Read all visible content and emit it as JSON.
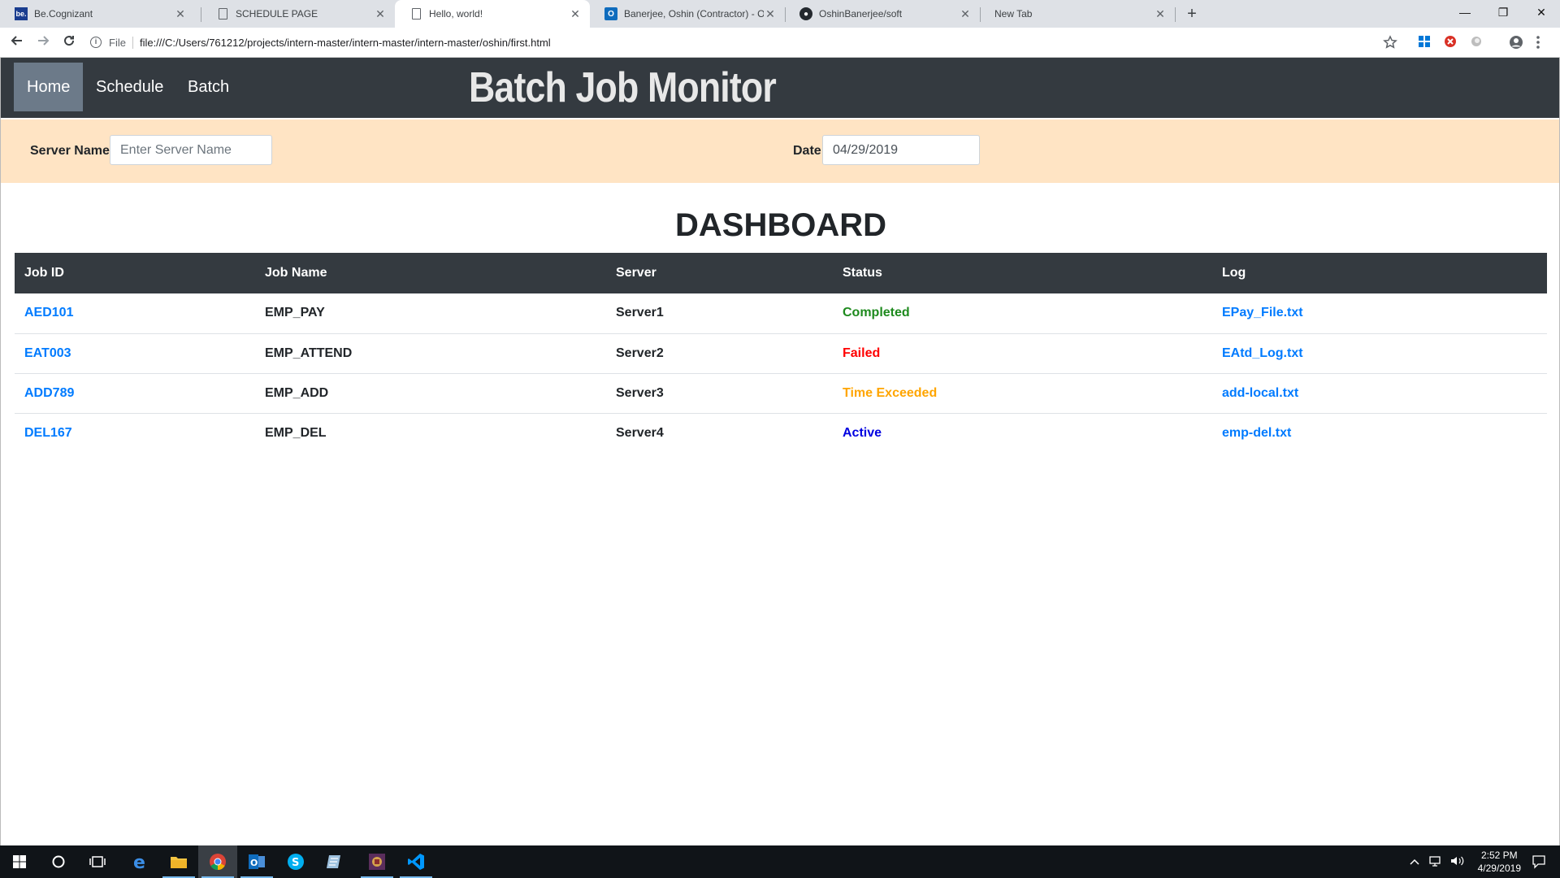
{
  "browser": {
    "tabs": [
      {
        "title": "Be.Cognizant",
        "icon": "be-icon",
        "icon_text": "be."
      },
      {
        "title": "SCHEDULE PAGE",
        "icon": "document-icon",
        "icon_text": ""
      },
      {
        "title": "Hello, world!",
        "icon": "document-icon",
        "icon_text": ""
      },
      {
        "title": "Banerjee, Oshin (Contractor) - Ou",
        "icon": "outlook-icon",
        "icon_text": "O"
      },
      {
        "title": "OshinBanerjee/soft",
        "icon": "github-icon",
        "icon_text": "●"
      },
      {
        "title": "New Tab",
        "icon": "",
        "icon_text": ""
      }
    ],
    "new_tab_glyph": "+",
    "window_controls": {
      "minimize": "—",
      "restore": "❐",
      "close": "✕"
    },
    "address": {
      "scheme_label": "File",
      "url": "file:///C:/Users/761212/projects/intern-master/intern-master/intern-master/oshin/first.html"
    }
  },
  "navbar": {
    "links": [
      {
        "label": "Home"
      },
      {
        "label": "Schedule"
      },
      {
        "label": "Batch"
      }
    ],
    "brand": "Batch Job Monitor"
  },
  "filters": {
    "server_label": "Server Name",
    "server_placeholder": "Enter Server Name",
    "date_label": "Date",
    "date_value": "04/29/2019"
  },
  "dashboard": {
    "title": "DASHBOARD",
    "columns": [
      "Job ID",
      "Job Name",
      "Server",
      "Status",
      "Log"
    ],
    "rows": [
      {
        "job_id": "AED101",
        "job_name": "EMP_PAY",
        "server": "Server1",
        "status": "Completed",
        "status_color": "#1e8a1e",
        "log": "EPay_File.txt"
      },
      {
        "job_id": "EAT003",
        "job_name": "EMP_ATTEND",
        "server": "Server2",
        "status": "Failed",
        "status_color": "#ff0000",
        "log": "EAtd_Log.txt"
      },
      {
        "job_id": "ADD789",
        "job_name": "EMP_ADD",
        "server": "Server3",
        "status": "Time Exceeded",
        "status_color": "#ffa500",
        "log": "add-local.txt"
      },
      {
        "job_id": "DEL167",
        "job_name": "EMP_DEL",
        "server": "Server4",
        "status": "Active",
        "status_color": "#0000e0",
        "log": "emp-del.txt"
      }
    ]
  },
  "taskbar": {
    "time": "2:52 PM",
    "date": "4/29/2019"
  }
}
